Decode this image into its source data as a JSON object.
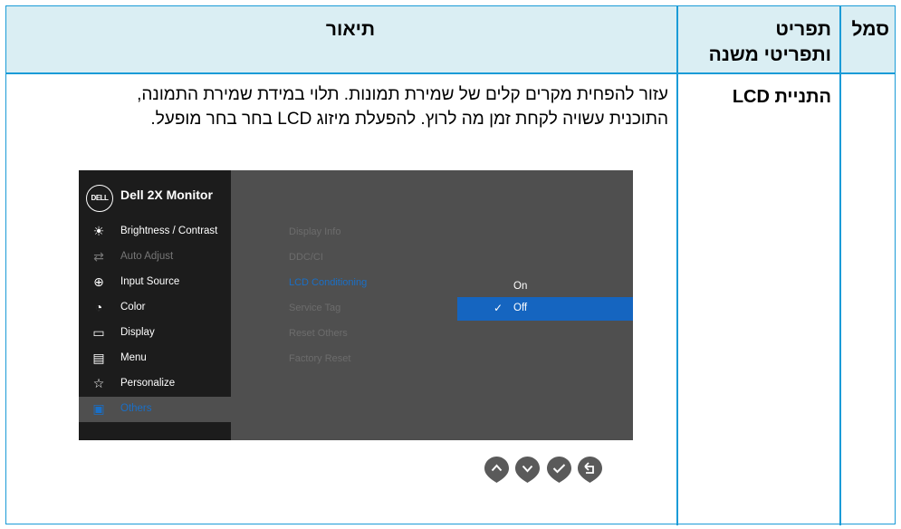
{
  "header": {
    "symbol": "סמל",
    "submenu_line1": "תפריט",
    "submenu_line2": "ותפריטי משנה",
    "description": "תיאור"
  },
  "row": {
    "submenu_name": "התניית LCD",
    "description_lines": [
      "עזור להפחית מקרים קלים של שמירת תמונות. תלוי במידת שמירת התמונה,",
      "התוכנית עשויה לקחת זמן מה לרוץ. להפעלת מיזוג LCD בחר בחר מופעל."
    ]
  },
  "osd": {
    "logo": "DELL",
    "title": "Dell 2X Monitor",
    "menu_items": [
      {
        "label": "Brightness / Contrast",
        "icon": "brightness-icon",
        "state": "normal"
      },
      {
        "label": "Auto Adjust",
        "icon": "auto-adjust-icon",
        "state": "disabled"
      },
      {
        "label": "Input Source",
        "icon": "input-source-icon",
        "state": "normal"
      },
      {
        "label": "Color",
        "icon": "color-icon",
        "state": "normal"
      },
      {
        "label": "Display",
        "icon": "display-icon",
        "state": "normal"
      },
      {
        "label": "Menu",
        "icon": "menu-icon",
        "state": "normal"
      },
      {
        "label": "Personalize",
        "icon": "star-icon",
        "state": "normal"
      },
      {
        "label": "Others",
        "icon": "others-icon",
        "state": "active"
      }
    ],
    "sub_items": [
      {
        "label": "Display Info",
        "state": "normal"
      },
      {
        "label": "DDC/CI",
        "state": "normal"
      },
      {
        "label": "LCD Conditioning",
        "state": "active"
      },
      {
        "label": "Service Tag",
        "state": "normal"
      },
      {
        "label": "Reset Others",
        "state": "normal"
      },
      {
        "label": "Factory Reset",
        "state": "normal"
      }
    ],
    "options": {
      "on": "On",
      "off": "Off",
      "selected": "Off"
    },
    "accent": "#1565c0"
  },
  "buttons": [
    {
      "icon": "chevron-up-icon"
    },
    {
      "icon": "chevron-down-icon"
    },
    {
      "icon": "check-icon"
    },
    {
      "icon": "back-icon"
    }
  ],
  "colors": {
    "border": "#1a9bd7",
    "header_bg": "#daeef3"
  }
}
